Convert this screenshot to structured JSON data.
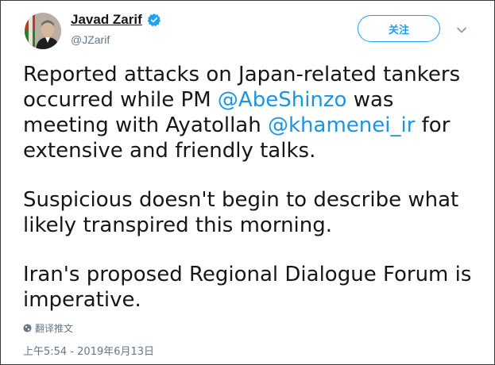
{
  "user": {
    "display_name": "Javad Zarif",
    "handle": "@JZarif",
    "verified": true,
    "avatar_icon": "profile-photo"
  },
  "actions": {
    "follow_label": "关注",
    "menu_icon": "chevron-down-icon"
  },
  "tweet": {
    "para1": {
      "text_before_mention1": "Reported attacks on Japan-related tankers occurred while PM ",
      "mention1": "@AbeShinzo",
      "text_between": " was meeting with Ayatollah ",
      "mention2": "@khamenei_ir",
      "text_after": " for extensive and friendly talks."
    },
    "para2": "Suspicious doesn't begin to describe what likely transpired this morning.",
    "para3": "Iran's proposed Regional Dialogue Forum is imperative."
  },
  "translate": {
    "label": "翻译推文",
    "icon": "globe-icon"
  },
  "timestamp": "上午5:54 - 2019年6月13日",
  "colors": {
    "accent": "#1da1f2",
    "mention": "#1b95e0",
    "secondary_text": "#657786",
    "primary_text": "#14171a"
  }
}
